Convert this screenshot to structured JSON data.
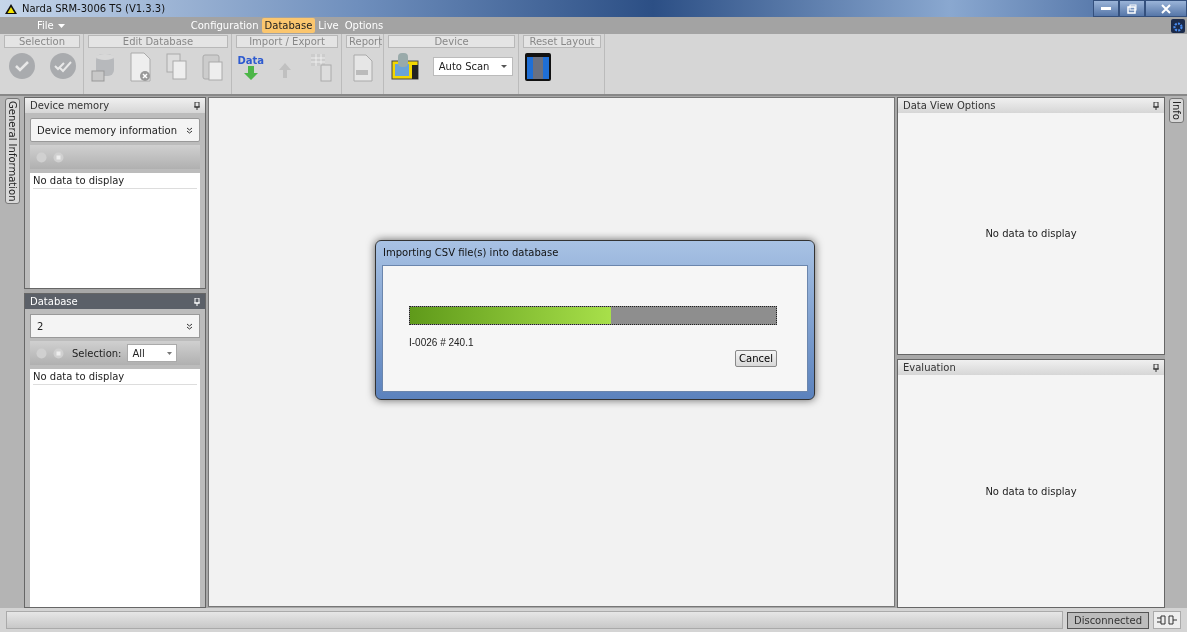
{
  "window": {
    "title": "Narda SRM-3006 TS  (V1.3.3)"
  },
  "menu": [
    {
      "label": "File",
      "selected": false,
      "dropdown": true
    },
    {
      "label": "Configuration",
      "selected": false,
      "dropdown": false
    },
    {
      "label": "Database",
      "selected": true,
      "dropdown": false
    },
    {
      "label": "Live",
      "selected": false,
      "dropdown": false
    },
    {
      "label": "Options",
      "selected": false,
      "dropdown": false
    }
  ],
  "ribbon": [
    {
      "label": "Selection",
      "tools": [
        {
          "kind": "check"
        },
        {
          "kind": "double-check"
        }
      ]
    },
    {
      "label": "Edit Database",
      "tools": [
        {
          "kind": "database"
        },
        {
          "kind": "doc-delete"
        },
        {
          "kind": "copy"
        },
        {
          "kind": "paste"
        }
      ]
    },
    {
      "label": "Import / Export",
      "tools": [
        {
          "kind": "import",
          "label": "Data"
        },
        {
          "kind": "export"
        },
        {
          "kind": "grid"
        }
      ]
    },
    {
      "label": "Report",
      "tools": [
        {
          "kind": "report"
        }
      ]
    },
    {
      "label": "Device",
      "tools": [
        {
          "kind": "device"
        },
        {
          "kind": "dropdown",
          "value": "Auto Scan"
        }
      ]
    },
    {
      "label": "Reset Layout",
      "tools": [
        {
          "kind": "reset"
        }
      ]
    }
  ],
  "left_tab": "General Information",
  "right_tab": "Info",
  "device_memory": {
    "title": "Device memory",
    "dropdown": "Device memory information",
    "empty": "No data to display"
  },
  "database": {
    "title": "Database",
    "dropdown": "2",
    "selection_label": "Selection:",
    "selection_value": "All",
    "empty": "No data to display"
  },
  "dialog": {
    "title": "Importing CSV file(s) into database",
    "level": 0.55,
    "status": "I-0026 # 240.1",
    "button": "Cancel"
  },
  "data_view_options": {
    "title": "Data View Options",
    "empty": "No data to display"
  },
  "evaluation": {
    "title": "Evaluation",
    "empty": "No data to display"
  },
  "status_bar": {
    "status": "Disconnected"
  }
}
